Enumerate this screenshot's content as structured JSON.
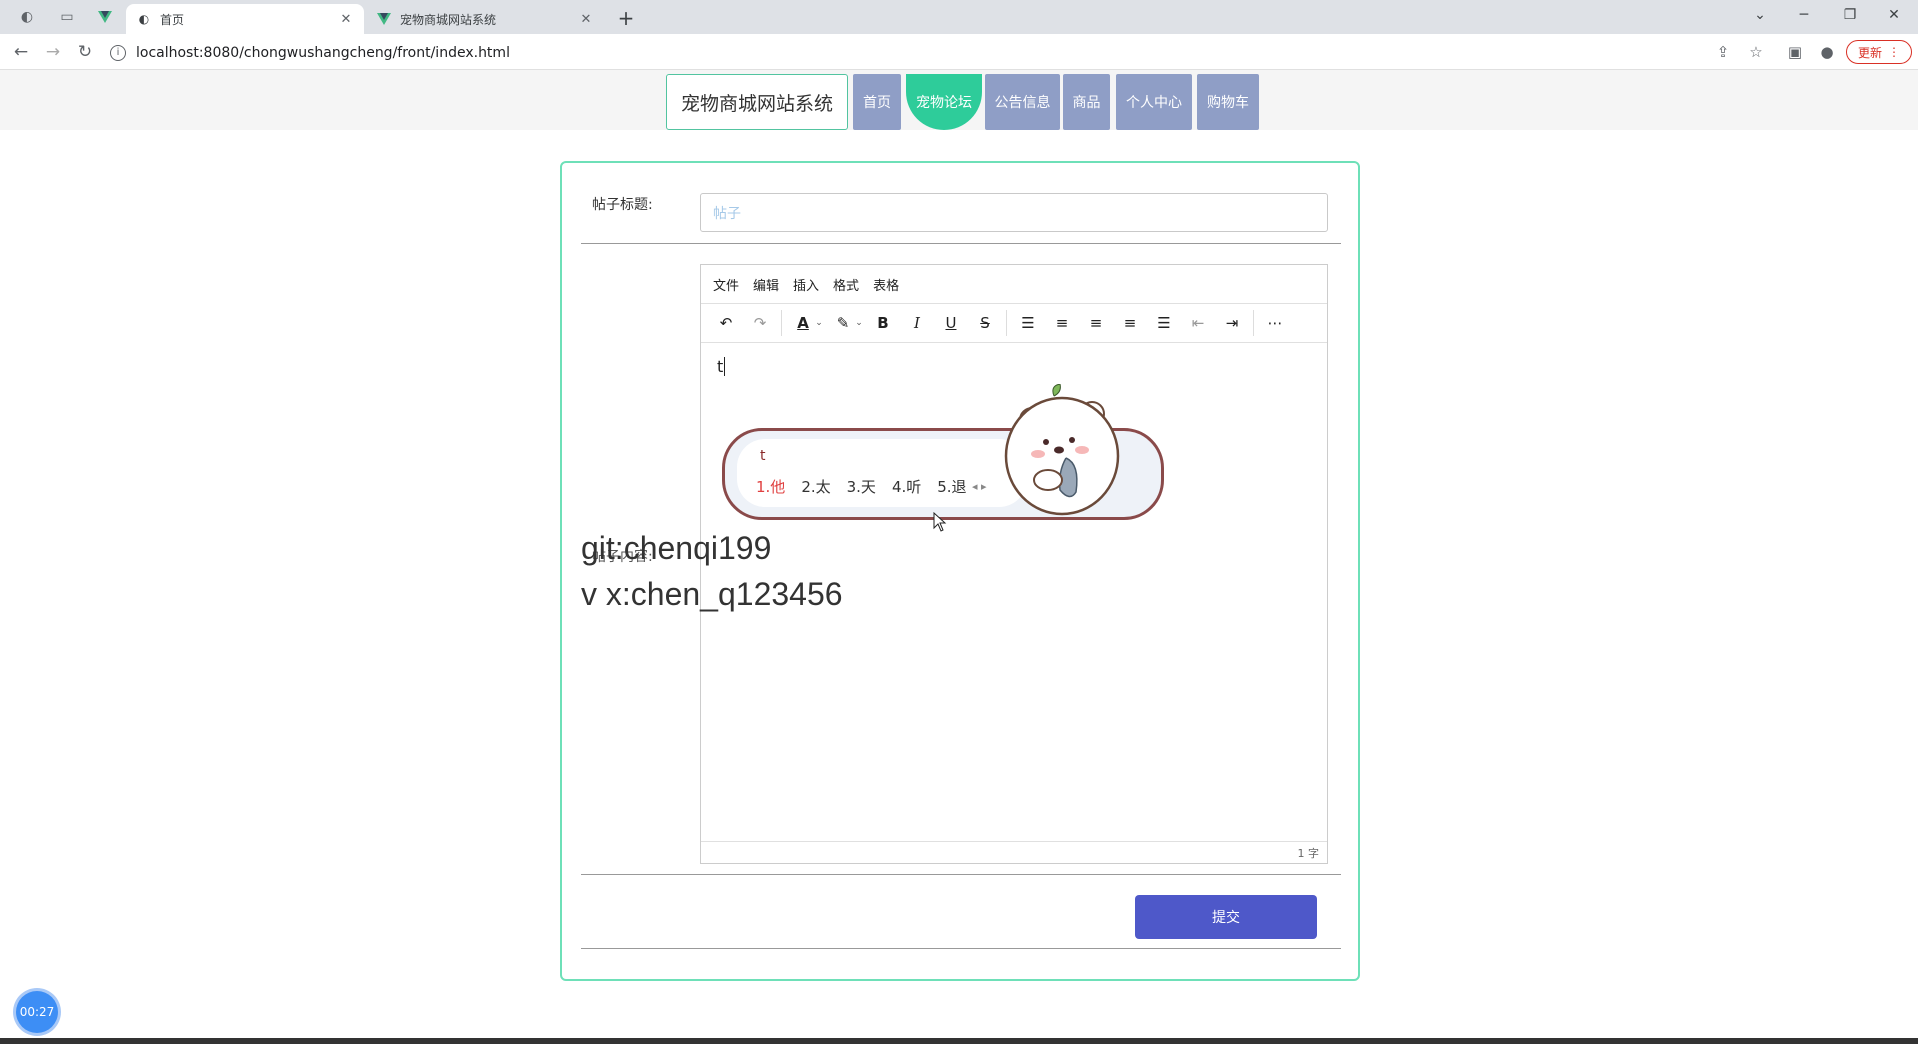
{
  "browser": {
    "tabs": [
      {
        "title": "",
        "icon": "globe-icon"
      },
      {
        "title": "",
        "icon": "blank-tab-icon"
      },
      {
        "title": "",
        "icon": "vue-icon"
      },
      {
        "title": "首页",
        "icon": "globe-icon",
        "active": true
      },
      {
        "title": "宠物商城网站系统",
        "icon": "vue-icon"
      }
    ],
    "url": "localhost:8080/chongwushangcheng/front/index.html",
    "update_label": "更新"
  },
  "site": {
    "brand": "宠物商城网站系统",
    "nav": [
      "首页",
      "宠物论坛",
      "公告信息",
      "商品",
      "个人中心",
      "购物车"
    ],
    "active_nav": "宠物论坛"
  },
  "form": {
    "title_label": "帖子标题:",
    "title_placeholder": "帖子",
    "editor_menu": [
      "文件",
      "编辑",
      "插入",
      "格式",
      "表格"
    ],
    "editor_text": "t",
    "word_count": "1 字",
    "hidden_label": "帖子内容:",
    "submit_label": "提交"
  },
  "ime": {
    "composition": "t",
    "candidates": [
      "1.他",
      "2.太",
      "3.天",
      "4.听",
      "5.退"
    ]
  },
  "watermark": {
    "line1": "git:chenqi199",
    "line2": "v x:chen_q123456"
  },
  "recorder": {
    "time": "00:27"
  }
}
